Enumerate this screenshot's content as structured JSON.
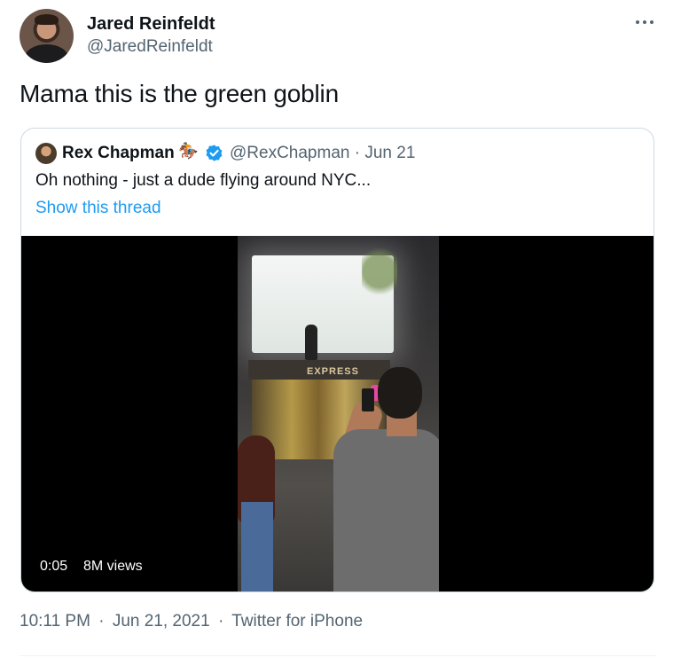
{
  "author": {
    "name": "Jared Reinfeldt",
    "handle": "@JaredReinfeldt"
  },
  "tweet_text": "Mama this is the green goblin",
  "quoted": {
    "name": "Rex Chapman",
    "emoji": "🏇🏼",
    "handle_date": "@RexChapman · Jun 21",
    "text": "Oh nothing - just a dude flying around NYC...",
    "show_thread": "Show this thread",
    "video": {
      "store_sign": "EXPRESS",
      "time": "0:05",
      "views": "8M views"
    }
  },
  "meta": {
    "time": "10:11 PM",
    "sep": "·",
    "date": "Jun 21, 2021",
    "source": "Twitter for iPhone"
  },
  "colors": {
    "accent": "#1d9bf0",
    "secondary_text": "#536471",
    "border": "#cfd9de"
  },
  "icons": [
    "more-icon",
    "verified-badge-icon"
  ]
}
